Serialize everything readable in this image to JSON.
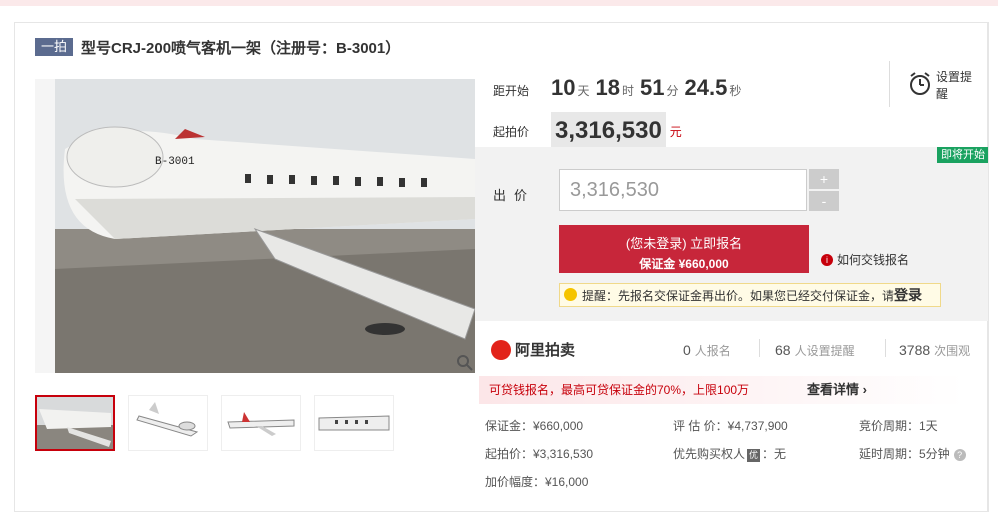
{
  "header": {
    "tag": "一拍",
    "title": "型号CRJ-200喷气客机一架（注册号：B-3001）"
  },
  "countdown": {
    "label": "距开始",
    "days": "10",
    "days_unit": "天",
    "hours": "18",
    "hours_unit": "时",
    "minutes": "51",
    "minutes_unit": "分",
    "seconds": "24.5",
    "seconds_unit": "秒"
  },
  "reminder": {
    "label": "设置提醒"
  },
  "start_price": {
    "label": "起拍价",
    "value": "3,316,530",
    "unit": "元"
  },
  "bid": {
    "badge": "即将开始",
    "label": "出价",
    "input_value": "3,316,530",
    "plus": "+",
    "minus": "-",
    "signup_main": "(您未登录) 立即报名",
    "signup_sub": "保证金 ¥660,000",
    "howto": "如何交钱报名",
    "tip": "提醒：先报名交保证金再出价。如果您已经交付保证金，请",
    "tip_link": "登录"
  },
  "stats": {
    "logo": "阿里拍卖",
    "signups": "0",
    "signups_unit": "人报名",
    "reminders": "68",
    "reminders_unit": "人设置提醒",
    "views": "3788",
    "views_unit": "次围观"
  },
  "promo": {
    "text": "可贷钱报名，最高可贷保证金的70%，上限100万",
    "more": "查看详情"
  },
  "details": {
    "deposit": "保证金：¥660,000",
    "appraisal": "评 估 价：¥4,737,900",
    "cycle": "竞价周期：1天",
    "start": "起拍价：¥3,316,530",
    "priority_a": "优先购买权人",
    "priority_icon": "优",
    "priority_b": "：无",
    "delay": "延时周期：5分钟",
    "help": "?",
    "increment": "加价幅度：¥16,000"
  },
  "aircraft": {
    "registration": "B-3001"
  },
  "colors": {
    "accent": "#c7263a",
    "badge": "#1aa260",
    "tag": "#5b6b8f"
  }
}
